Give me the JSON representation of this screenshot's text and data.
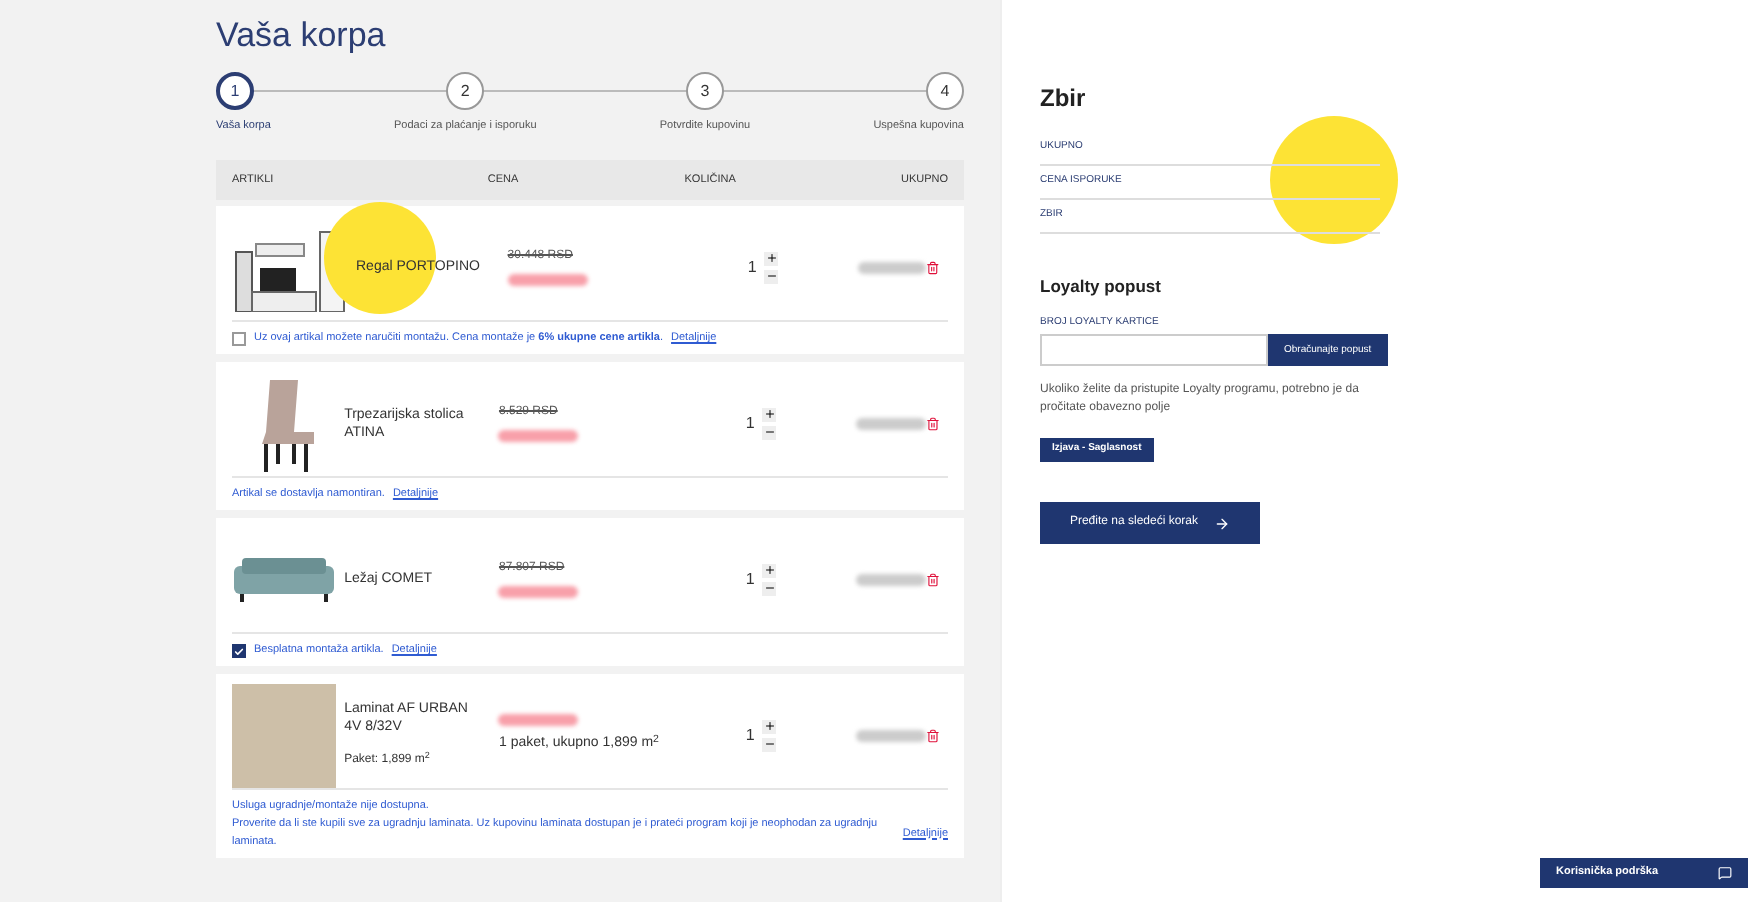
{
  "title": "Vaša korpa",
  "steps": [
    {
      "number": "1",
      "label": "Vaša korpa",
      "selected": true
    },
    {
      "number": "2",
      "label": "Podaci za plaćanje i isporuku",
      "selected": false
    },
    {
      "number": "3",
      "label": "Potvrdite kupovinu",
      "selected": false
    },
    {
      "number": "4",
      "label": "Uspešna kupovina",
      "selected": false
    }
  ],
  "table": {
    "columns": [
      "ARTIKLI",
      "CENA",
      "KOLIČINA",
      "UKUPNO"
    ],
    "items": [
      {
        "kind": "shelf",
        "name": "Regal PORTOPINO",
        "highlighted": true,
        "old_price": "30.448 RSD",
        "quantity": "1",
        "notes": [
          {
            "kind": "checkbox",
            "checked": false,
            "text": "Uz ovaj artikal možete naručiti montažu. Cena montaže je **6% ukupne cene artikla**.",
            "link": "Detaljnije"
          }
        ]
      },
      {
        "kind": "chair",
        "name": "Trpezarijska stolica ATINA",
        "highlighted": false,
        "old_price": "8.529 RSD",
        "quantity": "1",
        "notes": [
          {
            "kind": "text",
            "text": "Artikal se dostavlja namontiran.",
            "link": "Detaljnije"
          }
        ]
      },
      {
        "kind": "sofa",
        "name": "Ležaj COMET",
        "highlighted": false,
        "old_price": "87.807 RSD",
        "quantity": "1",
        "notes": [
          {
            "kind": "checkbox",
            "checked": true,
            "text": "Besplatna montaža artikla.",
            "link": "Detaljnije"
          }
        ]
      },
      {
        "kind": "laminate",
        "name": "Laminat AF URBAN 4V 8/32V",
        "package": "Paket: 1,899 m$^{2}$",
        "price_note": "1 paket, ukupno 1,899 m$^{2}$",
        "highlighted": false,
        "quantity": "1",
        "notes": [
          {
            "kind": "text",
            "text": "Usluga ugradnje/montaže nije dostupna."
          },
          {
            "kind": "text",
            "text": "Proverite da li ste kupili sve za ugradnju laminata. Uz kupovinu laminata dostupan je i prateći program koji je neophodan za ugradnju laminata.",
            "link": "Detaljnije"
          }
        ]
      }
    ]
  },
  "summary": {
    "title": "Zbir",
    "rows": [
      "UKUPNO",
      "CENA ISPORUKE",
      "ZBIR"
    ],
    "highlighted": true
  },
  "loyalty": {
    "title": "Loyalty popust",
    "field_label": "BROJ LOYALTY KARTICE",
    "button": "Obračunajte popust",
    "info": "Ukoliko želite da pristupite Loyalty programu, potrebno je da pročitate obavezno polje",
    "consent_button": "Izjava - Saglasnost"
  },
  "next_button": "Pređite na sledeći korak",
  "support": "Korisnička podrška"
}
